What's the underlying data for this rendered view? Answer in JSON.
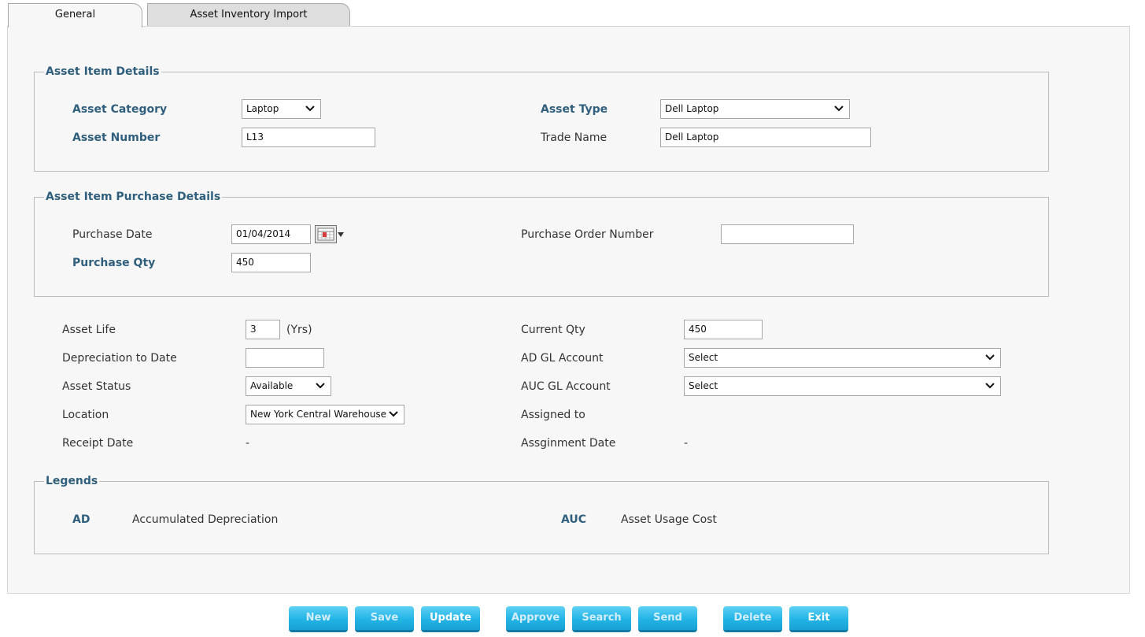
{
  "tabs": [
    {
      "label": "General",
      "active": true
    },
    {
      "label": "Asset Inventory Import",
      "active": false
    }
  ],
  "asset_item_details": {
    "legend": "Asset Item Details",
    "asset_category": {
      "label": "Asset Category",
      "value": "Laptop"
    },
    "asset_type": {
      "label": "Asset Type",
      "value": "Dell Laptop"
    },
    "asset_number": {
      "label": "Asset Number",
      "value": "L13"
    },
    "trade_name": {
      "label": "Trade Name",
      "value": "Dell Laptop"
    }
  },
  "purchase_details": {
    "legend": "Asset Item Purchase Details",
    "purchase_date": {
      "label": "Purchase Date",
      "value": "01/04/2014"
    },
    "purchase_order_number": {
      "label": "Purchase Order Number",
      "value": ""
    },
    "purchase_qty": {
      "label": "Purchase Qty",
      "value": "450"
    }
  },
  "general": {
    "asset_life": {
      "label": "Asset Life",
      "value": "3",
      "unit": "(Yrs)"
    },
    "current_qty": {
      "label": "Current Qty",
      "value": "450"
    },
    "depreciation_to_date": {
      "label": "Depreciation to Date",
      "value": ""
    },
    "ad_gl_account": {
      "label": "AD GL Account",
      "value": "Select"
    },
    "asset_status": {
      "label": "Asset Status",
      "value": "Available"
    },
    "auc_gl_account": {
      "label": "AUC GL Account",
      "value": "Select"
    },
    "location": {
      "label": "Location",
      "value": "New York Central Warehouse"
    },
    "assigned_to": {
      "label": "Assigned to",
      "value": ""
    },
    "receipt_date": {
      "label": "Receipt Date",
      "value": "-"
    },
    "assignment_date": {
      "label": "Assginment Date",
      "value": "-"
    }
  },
  "legends": {
    "legend": "Legends",
    "items": [
      {
        "abbr": "AD",
        "meaning": "Accumulated Depreciation"
      },
      {
        "abbr": "AUC",
        "meaning": "Asset Usage Cost"
      }
    ]
  },
  "buttons": [
    {
      "label": "New",
      "enabled": false
    },
    {
      "label": "Save",
      "enabled": false
    },
    {
      "label": "Update",
      "enabled": true
    },
    {
      "label": "Approve",
      "enabled": false
    },
    {
      "label": "Search",
      "enabled": false
    },
    {
      "label": "Send",
      "enabled": false
    },
    {
      "label": "Delete",
      "enabled": false
    },
    {
      "label": "Exit",
      "enabled": true
    }
  ],
  "colors": {
    "label_accent": "#2f5f7d",
    "button": "#22b4e6",
    "panel_bg": "#f7f7f7"
  }
}
